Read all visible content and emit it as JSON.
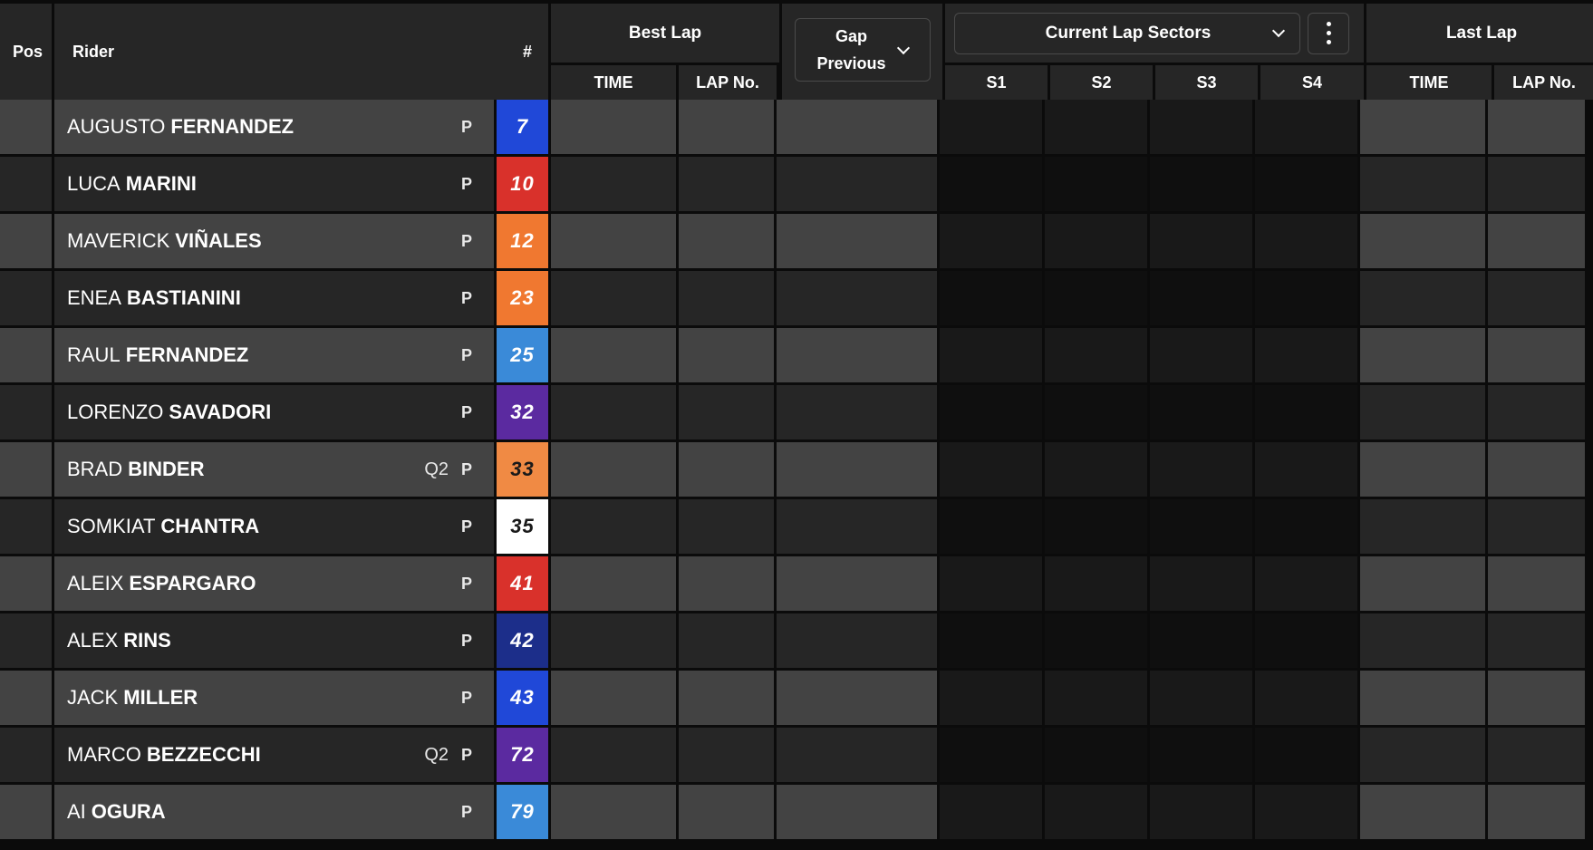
{
  "header": {
    "pos": "Pos",
    "rider": "Rider",
    "number": "#",
    "best_lap": {
      "title": "Best Lap",
      "time": "TIME",
      "lap_no": "LAP No."
    },
    "gap": {
      "line1": "Gap",
      "line2": "Previous"
    },
    "sectors": {
      "selected": "Current Lap Sectors",
      "s1": "S1",
      "s2": "S2",
      "s3": "S3",
      "s4": "S4"
    },
    "last_lap": {
      "title": "Last Lap",
      "time": "TIME",
      "lap_no": "LAP No."
    }
  },
  "pit_symbol": "P",
  "riders": [
    {
      "first": "AUGUSTO",
      "last": "FERNANDEZ",
      "q": "",
      "number": "7",
      "color": "#2048d8",
      "text": "#ffffff"
    },
    {
      "first": "LUCA",
      "last": "MARINI",
      "q": "",
      "number": "10",
      "color": "#d9312b",
      "text": "#ffffff"
    },
    {
      "first": "MAVERICK",
      "last": "VIÑALES",
      "q": "",
      "number": "12",
      "color": "#f07830",
      "text": "#ffffff"
    },
    {
      "first": "ENEA",
      "last": "BASTIANINI",
      "q": "",
      "number": "23",
      "color": "#f07830",
      "text": "#ffffff"
    },
    {
      "first": "RAUL",
      "last": "FERNANDEZ",
      "q": "",
      "number": "25",
      "color": "#3a8ad8",
      "text": "#ffffff"
    },
    {
      "first": "LORENZO",
      "last": "SAVADORI",
      "q": "",
      "number": "32",
      "color": "#5b2aa0",
      "text": "#ffffff"
    },
    {
      "first": "BRAD",
      "last": "BINDER",
      "q": "Q2",
      "number": "33",
      "color": "#f08a44",
      "text": "#1a1a1a"
    },
    {
      "first": "SOMKIAT",
      "last": "CHANTRA",
      "q": "",
      "number": "35",
      "color": "#ffffff",
      "text": "#1a1a1a"
    },
    {
      "first": "ALEIX",
      "last": "ESPARGARO",
      "q": "",
      "number": "41",
      "color": "#d9312b",
      "text": "#ffffff"
    },
    {
      "first": "ALEX",
      "last": "RINS",
      "q": "",
      "number": "42",
      "color": "#1c2e8a",
      "text": "#ffffff"
    },
    {
      "first": "JACK",
      "last": "MILLER",
      "q": "",
      "number": "43",
      "color": "#2048d8",
      "text": "#ffffff"
    },
    {
      "first": "MARCO",
      "last": "BEZZECCHI",
      "q": "Q2",
      "number": "72",
      "color": "#5b2aa0",
      "text": "#ffffff"
    },
    {
      "first": "AI",
      "last": "OGURA",
      "q": "",
      "number": "79",
      "color": "#3a8ad8",
      "text": "#ffffff"
    }
  ]
}
